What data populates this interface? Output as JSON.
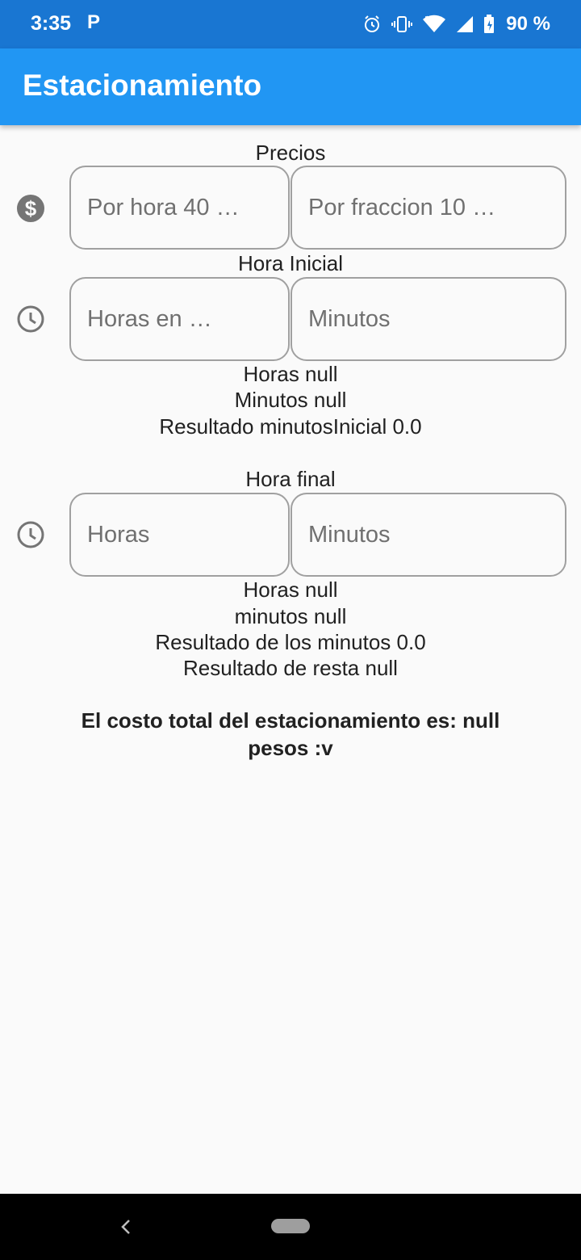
{
  "status_bar": {
    "time": "3:35",
    "notification_letter": "P",
    "battery": "90 %",
    "icons": [
      "alarm-icon",
      "vibrate-icon",
      "wifi-icon",
      "signal-icon",
      "battery-icon"
    ]
  },
  "app_bar": {
    "title": "Estacionamiento"
  },
  "prices": {
    "label": "Precios",
    "icon": "dollar-icon",
    "per_hour_placeholder": "Por hora 40 …",
    "per_fraction_placeholder": "Por fraccion 10 …"
  },
  "start_time": {
    "label": "Hora Inicial",
    "icon": "clock-icon",
    "hours_placeholder": "Horas en …",
    "minutes_placeholder": "Minutos",
    "hours_text": "Horas null",
    "minutes_text": "Minutos null",
    "result_text": "Resultado minutosInicial 0.0"
  },
  "end_time": {
    "label": "Hora final",
    "icon": "clock-icon",
    "hours_placeholder": "Horas",
    "minutes_placeholder": "Minutos",
    "hours_text": "Horas null",
    "minutes_text": "minutos null",
    "result_minutes_text": "Resultado de los minutos 0.0",
    "result_subtract_text": "Resultado de resta null"
  },
  "total": {
    "line1": "El costo total del estacionamiento es: null",
    "line2": "pesos :v"
  },
  "colors": {
    "status_bar": "#1976d2",
    "app_bar": "#2196f3",
    "background": "#fafafa",
    "field_border": "#a0a0a0"
  }
}
